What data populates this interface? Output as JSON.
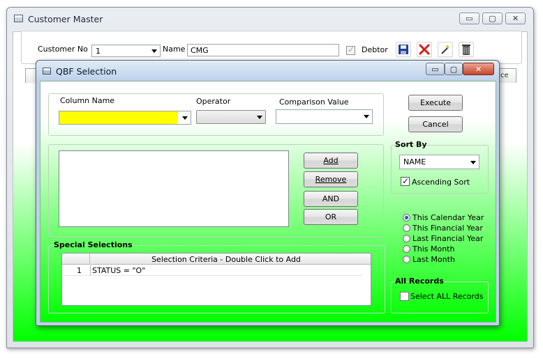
{
  "window": {
    "title": "Customer Master",
    "minimize": "▭",
    "maximize": "▢",
    "close": "✕"
  },
  "header": {
    "customer_no_label": "Customer No",
    "customer_no_value": "1",
    "name_label": "Name",
    "name_value": "CMG",
    "debtor_label": "Debtor",
    "debtor_checked": true
  },
  "toolbar": {
    "icons": [
      "save-icon",
      "delete-icon",
      "wand-icon",
      "trash-icon"
    ]
  },
  "outer_tabs": {
    "last_tab_label": "ce"
  },
  "dialog": {
    "title": "QBF Selection",
    "criteria": {
      "column_name_label": "Column Name",
      "column_name_value": "",
      "operator_label": "Operator",
      "operator_value": "",
      "comparison_value_label": "Comparison Value",
      "comparison_value": ""
    },
    "buttons": {
      "execute": "Execute",
      "cancel": "Cancel",
      "add": "Add",
      "remove": "Remove",
      "and": "AND",
      "or": "OR"
    },
    "sort_by": {
      "title": "Sort By",
      "field": "NAME",
      "ascending_label": "Ascending Sort",
      "ascending_checked": true
    },
    "periods": [
      {
        "label": "This Calendar Year",
        "selected": true
      },
      {
        "label": "This Financial Year",
        "selected": false
      },
      {
        "label": "Last Financial Year",
        "selected": false
      },
      {
        "label": "This Month",
        "selected": false
      },
      {
        "label": "Last Month",
        "selected": false
      }
    ],
    "special_selections": {
      "title": "Special Selections",
      "column_header": "Selection Criteria - Double Click to Add",
      "rows": [
        {
          "index": "1",
          "criteria": "STATUS = \"O\""
        }
      ]
    },
    "all_records": {
      "title": "All Records",
      "select_all_label": "Select ALL Records",
      "checked": false
    }
  },
  "colors": {
    "accent_green": "#00ff00",
    "highlight_yellow": "#ffff00",
    "radio_dot": "#1a5fb4"
  }
}
